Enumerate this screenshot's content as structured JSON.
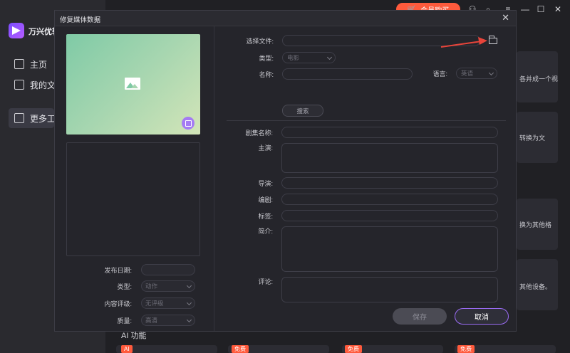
{
  "app": {
    "name": "万兴优转",
    "nav": [
      {
        "label": "主页",
        "icon": "home-icon"
      },
      {
        "label": "我的文",
        "icon": "folder-icon"
      },
      {
        "label": "更多工",
        "icon": "toolbox-icon"
      }
    ],
    "promo_label": "会员购买",
    "cards": [
      "各并成一个视",
      "转换为文",
      "换为其他格",
      "其他设备。"
    ],
    "ai_section_label": "AI 功能",
    "bottom_tags": [
      "AI",
      "免费",
      "免费",
      "免费"
    ]
  },
  "modal": {
    "title": "修复媒体数据",
    "close_glyph": "✕",
    "left": {
      "release_date": {
        "label": "发布日期:",
        "value": ""
      },
      "type": {
        "label": "类型:",
        "value": "动作"
      },
      "rating": {
        "label": "内容评级:",
        "value": "无评级"
      },
      "quality": {
        "label": "质量:",
        "value": "高清"
      }
    },
    "right": {
      "file": {
        "label": "选择文件:",
        "value": ""
      },
      "type": {
        "label": "类型:",
        "value": "电影"
      },
      "name": {
        "label": "名称:",
        "value": ""
      },
      "language": {
        "label": "语言:",
        "value": "英语"
      },
      "search_label": "搜索",
      "episode_name": {
        "label": "剧集名称:",
        "value": ""
      },
      "cast": {
        "label": "主演:",
        "value": ""
      },
      "director": {
        "label": "导演:",
        "value": ""
      },
      "writer": {
        "label": "编剧:",
        "value": ""
      },
      "tags": {
        "label": "标签:",
        "value": ""
      },
      "summary": {
        "label": "简介:",
        "value": ""
      },
      "comment": {
        "label": "评论:",
        "value": ""
      }
    },
    "save_label": "保存",
    "cancel_label": "取消"
  },
  "colors": {
    "accent": "#9b6cf5",
    "promo": "#ff5a3c",
    "annotation_arrow": "#e8443a"
  }
}
